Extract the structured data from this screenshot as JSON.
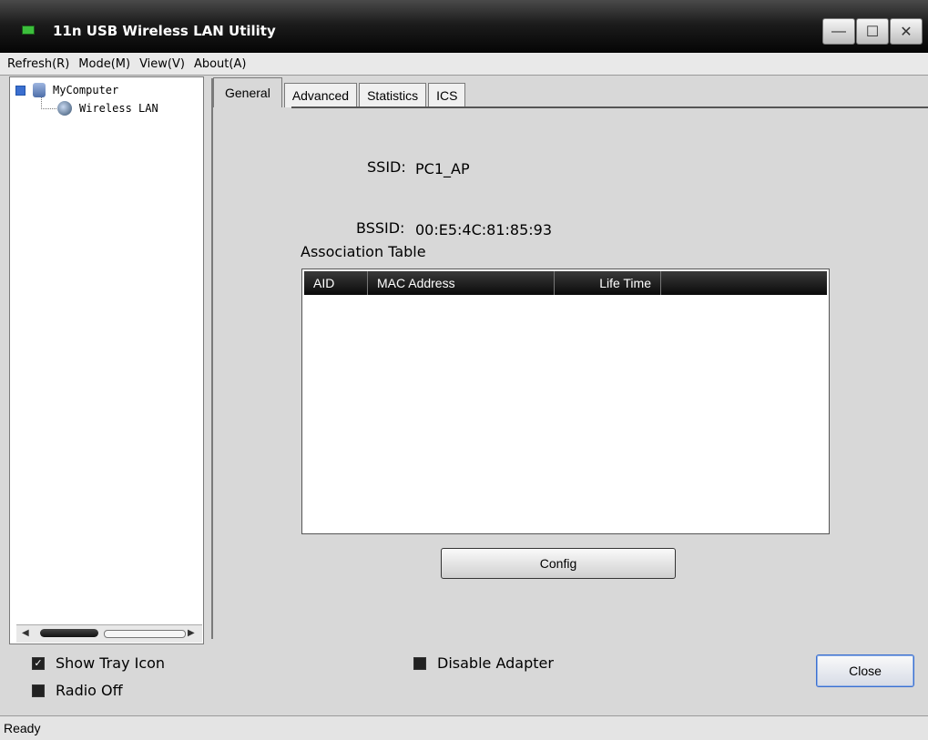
{
  "window": {
    "title": "11n USB Wireless LAN Utility",
    "buttons": {
      "minimize": "—",
      "maximize": "☐",
      "close": "✕"
    }
  },
  "menu": [
    "Refresh(R)",
    "Mode(M)",
    "View(V)",
    "About(A)"
  ],
  "tree": {
    "root": "MyComputer",
    "child": "Wireless LAN"
  },
  "tabs": [
    "General",
    "Advanced",
    "Statistics",
    "ICS"
  ],
  "general": {
    "ssid_label": "SSID:",
    "ssid_value": "PC1_AP",
    "bssid_label": "BSSID:",
    "bssid_value": "00:E5:4C:81:85:93",
    "association_title": "Association Table",
    "columns": [
      "AID",
      "MAC Address",
      "Life Time"
    ],
    "config_button": "Config"
  },
  "footer": {
    "show_tray_icon": "Show Tray Icon",
    "radio_off": "Radio Off",
    "disable_adapter": "Disable Adapter",
    "close_button": "Close",
    "show_tray_checked": true,
    "radio_off_checked": false,
    "disable_adapter_checked": false
  },
  "status": {
    "text": "Ready"
  },
  "colors": {
    "titlebar": "#1c1c1c",
    "accent": "#3b6fd0"
  }
}
